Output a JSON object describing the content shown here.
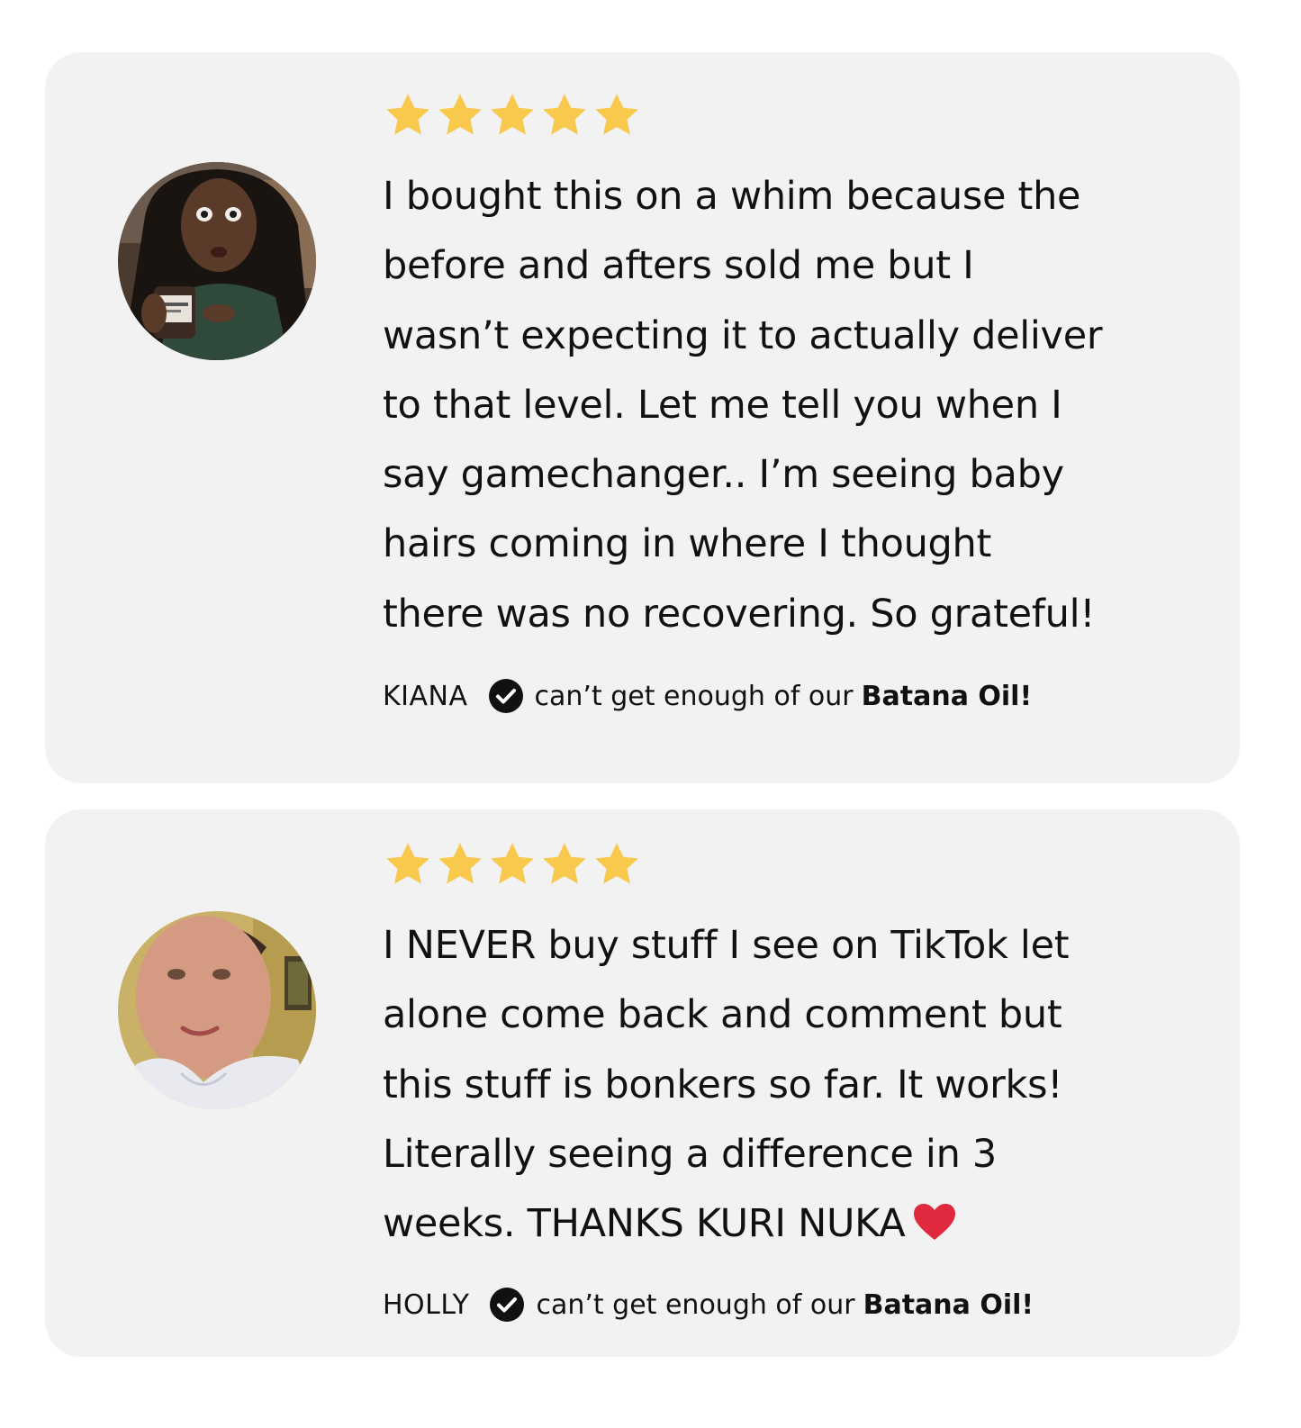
{
  "colors": {
    "card_background": "#f2f2f2",
    "star": "#f9c94d",
    "text": "#111111",
    "verified_badge": "#111111",
    "heart": "#e0293e"
  },
  "icons": {
    "rating": "star-icon",
    "verified": "check-circle-icon",
    "emoji": "heart-icon"
  },
  "reviews": [
    {
      "rating": 5,
      "lines": [
        "I bought this on a whim because the",
        "before and afters sold me but I",
        "wasn’t expecting it to actually deliver",
        "to that level. Let me tell you when I",
        "say gamechanger.. I’m seeing baby",
        "hairs coming in where I thought",
        "there was no recovering. So grateful!"
      ],
      "reviewer": "KIANA",
      "tagline": "can’t get enough of our",
      "product": "Batana Oil!"
    },
    {
      "rating": 5,
      "lines": [
        "I NEVER buy stuff I see on TikTok let",
        "alone come back and comment but",
        "this stuff is bonkers so far. It works!",
        "Literally seeing a difference in 3",
        "weeks. THANKS KURI NUKA"
      ],
      "reviewer": "HOLLY",
      "tagline": "can’t get enough of our",
      "product": "Batana Oil!"
    }
  ]
}
